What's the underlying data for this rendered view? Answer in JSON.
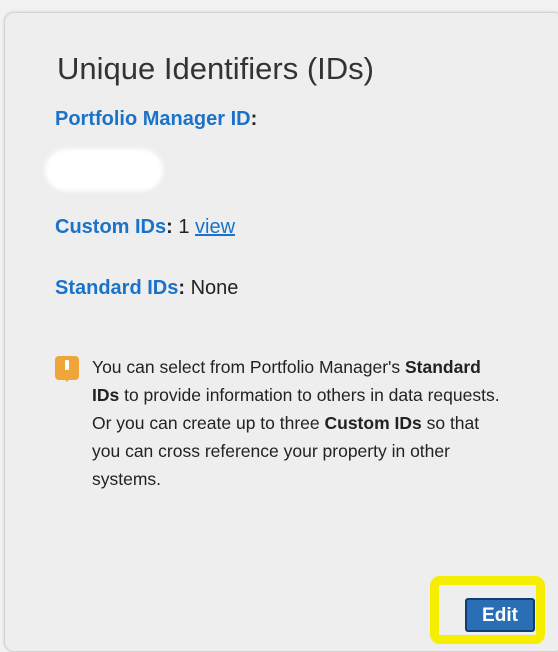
{
  "card": {
    "title": "Unique Identifiers (IDs)",
    "portfolio_manager_id": {
      "label": "Portfolio Manager ID",
      "separator": ":"
    },
    "custom_ids": {
      "label": "Custom IDs",
      "separator": ":",
      "value": "1",
      "link": "view"
    },
    "standard_ids": {
      "label": "Standard IDs",
      "separator": ":",
      "value": "None"
    },
    "info": {
      "icon": "info-icon",
      "text_1": "You can select from Portfolio Manager's ",
      "bold_1": "Standard IDs",
      "text_2": " to provide information to others in data requests. Or you can create up to three ",
      "bold_2": "Custom IDs",
      "text_3": " so that you can cross reference your property in other systems."
    },
    "edit_button": "Edit"
  },
  "colors": {
    "label_blue": "#1a73c8",
    "button_blue": "#2a6fb5",
    "highlight_yellow": "#f5ee00",
    "info_orange": "#f0a53a"
  }
}
